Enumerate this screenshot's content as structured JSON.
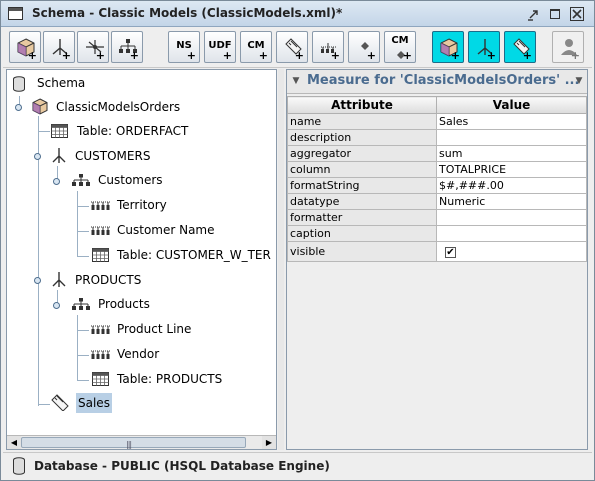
{
  "window": {
    "title": "Schema - Classic Models (ClassicModels.xml)*"
  },
  "toolbar": {
    "buttons": [
      {
        "name": "add-cube",
        "text": ""
      },
      {
        "name": "add-dimension",
        "text": ""
      },
      {
        "name": "add-dimension-usage",
        "text": ""
      },
      {
        "name": "add-hierarchy",
        "text": ""
      },
      {
        "name": "add-named-set",
        "text": "NS"
      },
      {
        "name": "add-user-defined-function",
        "text": "UDF"
      },
      {
        "name": "add-calculated-member",
        "text": "CM"
      },
      {
        "name": "add-measure",
        "text": ""
      },
      {
        "name": "add-level",
        "text": ""
      },
      {
        "name": "add-property",
        "text": ""
      },
      {
        "name": "add-calculated-member-property",
        "text": "CM"
      },
      {
        "name": "add-virtual-cube",
        "text": ""
      },
      {
        "name": "add-virtual-cube-dimension",
        "text": ""
      },
      {
        "name": "add-virtual-cube-measure",
        "text": ""
      },
      {
        "name": "add-role",
        "text": ""
      }
    ]
  },
  "tree": {
    "items": [
      {
        "label": "Schema",
        "icon": "database-icon"
      },
      {
        "label": "ClassicModelsOrders",
        "icon": "cube-icon"
      },
      {
        "label": "Table: ORDERFACT",
        "icon": "table-icon"
      },
      {
        "label": "CUSTOMERS",
        "icon": "dimension-icon"
      },
      {
        "label": "Customers",
        "icon": "hierarchy-icon"
      },
      {
        "label": "Territory",
        "icon": "level-icon"
      },
      {
        "label": "Customer Name",
        "icon": "level-icon"
      },
      {
        "label": "Table: CUSTOMER_W_TER",
        "icon": "table-icon"
      },
      {
        "label": "PRODUCTS",
        "icon": "dimension-icon"
      },
      {
        "label": "Products",
        "icon": "hierarchy-icon"
      },
      {
        "label": "Product Line",
        "icon": "level-icon"
      },
      {
        "label": "Vendor",
        "icon": "level-icon"
      },
      {
        "label": "Table: PRODUCTS",
        "icon": "table-icon"
      },
      {
        "label": "Sales",
        "icon": "measure-icon"
      }
    ]
  },
  "properties": {
    "title": "Measure for 'ClassicModelsOrders' ...",
    "header_attribute": "Attribute",
    "header_value": "Value",
    "rows": [
      {
        "attribute": "name",
        "value": "Sales"
      },
      {
        "attribute": "description",
        "value": ""
      },
      {
        "attribute": "aggregator",
        "value": "sum"
      },
      {
        "attribute": "column",
        "value": "TOTALPRICE"
      },
      {
        "attribute": "formatString",
        "value": "$#,###.00"
      },
      {
        "attribute": "datatype",
        "value": "Numeric"
      },
      {
        "attribute": "formatter",
        "value": ""
      },
      {
        "attribute": "caption",
        "value": ""
      }
    ],
    "visible_row": {
      "attribute": "visible",
      "checked": true,
      "check_glyph": "✔"
    }
  },
  "status": {
    "text": "Database - PUBLIC (HSQL Database Engine)"
  }
}
